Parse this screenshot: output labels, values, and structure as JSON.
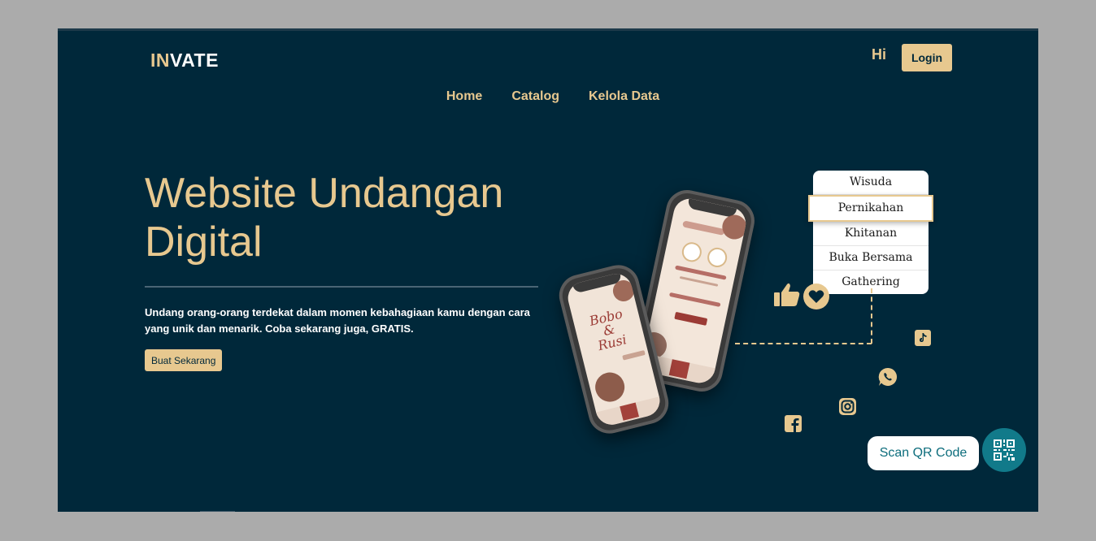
{
  "brand": {
    "part1": "IN",
    "part2": "VATE"
  },
  "header": {
    "greeting": "Hi",
    "login_label": "Login"
  },
  "nav": {
    "items": [
      "Home",
      "Catalog",
      "Kelola Data"
    ]
  },
  "hero": {
    "title_line1": "Website Undangan",
    "title_line2": "Digital",
    "description": "Undang orang-orang terdekat dalam momen kebahagiaan kamu dengan cara yang unik dan menarik. Coba sekarang juga, GRATIS.",
    "cta_label": "Buat Sekarang"
  },
  "categories": {
    "items": [
      "Wisuda",
      "Pernikahan",
      "Khitanan",
      "Buka Bersama",
      "Gathering"
    ],
    "selected": "Pernikahan"
  },
  "phone_front": {
    "title_line1": "Bobo",
    "title_line2": "&",
    "title_line3": "Rusi"
  },
  "scan": {
    "label": "Scan QR Code"
  },
  "colors": {
    "background": "#00283a",
    "accent": "#e7c88f",
    "qr_button": "#117a8a"
  },
  "icons": [
    "thumbs-up-icon",
    "heart-icon",
    "tiktok-icon",
    "whatsapp-icon",
    "instagram-icon",
    "facebook-icon",
    "qr-code-icon"
  ]
}
